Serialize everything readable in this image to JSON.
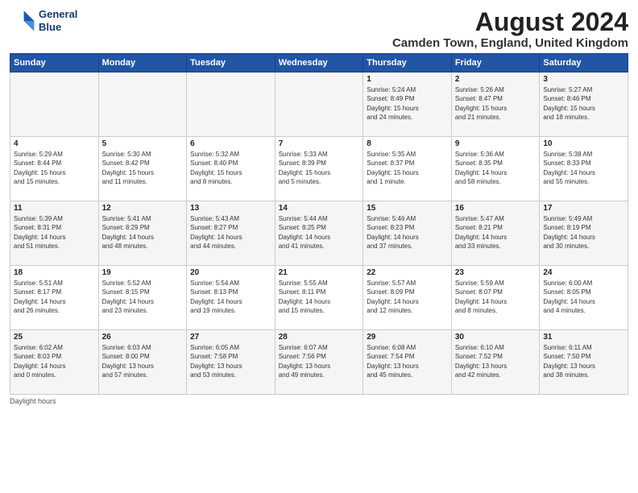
{
  "header": {
    "logo_line1": "General",
    "logo_line2": "Blue",
    "month_year": "August 2024",
    "location": "Camden Town, England, United Kingdom"
  },
  "columns": [
    "Sunday",
    "Monday",
    "Tuesday",
    "Wednesday",
    "Thursday",
    "Friday",
    "Saturday"
  ],
  "weeks": [
    {
      "days": [
        {
          "num": "",
          "info": ""
        },
        {
          "num": "",
          "info": ""
        },
        {
          "num": "",
          "info": ""
        },
        {
          "num": "",
          "info": ""
        },
        {
          "num": "1",
          "info": "Sunrise: 5:24 AM\nSunset: 8:49 PM\nDaylight: 15 hours\nand 24 minutes."
        },
        {
          "num": "2",
          "info": "Sunrise: 5:26 AM\nSunset: 8:47 PM\nDaylight: 15 hours\nand 21 minutes."
        },
        {
          "num": "3",
          "info": "Sunrise: 5:27 AM\nSunset: 8:46 PM\nDaylight: 15 hours\nand 18 minutes."
        }
      ]
    },
    {
      "days": [
        {
          "num": "4",
          "info": "Sunrise: 5:29 AM\nSunset: 8:44 PM\nDaylight: 15 hours\nand 15 minutes."
        },
        {
          "num": "5",
          "info": "Sunrise: 5:30 AM\nSunset: 8:42 PM\nDaylight: 15 hours\nand 11 minutes."
        },
        {
          "num": "6",
          "info": "Sunrise: 5:32 AM\nSunset: 8:40 PM\nDaylight: 15 hours\nand 8 minutes."
        },
        {
          "num": "7",
          "info": "Sunrise: 5:33 AM\nSunset: 8:39 PM\nDaylight: 15 hours\nand 5 minutes."
        },
        {
          "num": "8",
          "info": "Sunrise: 5:35 AM\nSunset: 8:37 PM\nDaylight: 15 hours\nand 1 minute."
        },
        {
          "num": "9",
          "info": "Sunrise: 5:36 AM\nSunset: 8:35 PM\nDaylight: 14 hours\nand 58 minutes."
        },
        {
          "num": "10",
          "info": "Sunrise: 5:38 AM\nSunset: 8:33 PM\nDaylight: 14 hours\nand 55 minutes."
        }
      ]
    },
    {
      "days": [
        {
          "num": "11",
          "info": "Sunrise: 5:39 AM\nSunset: 8:31 PM\nDaylight: 14 hours\nand 51 minutes."
        },
        {
          "num": "12",
          "info": "Sunrise: 5:41 AM\nSunset: 8:29 PM\nDaylight: 14 hours\nand 48 minutes."
        },
        {
          "num": "13",
          "info": "Sunrise: 5:43 AM\nSunset: 8:27 PM\nDaylight: 14 hours\nand 44 minutes."
        },
        {
          "num": "14",
          "info": "Sunrise: 5:44 AM\nSunset: 8:25 PM\nDaylight: 14 hours\nand 41 minutes."
        },
        {
          "num": "15",
          "info": "Sunrise: 5:46 AM\nSunset: 8:23 PM\nDaylight: 14 hours\nand 37 minutes."
        },
        {
          "num": "16",
          "info": "Sunrise: 5:47 AM\nSunset: 8:21 PM\nDaylight: 14 hours\nand 33 minutes."
        },
        {
          "num": "17",
          "info": "Sunrise: 5:49 AM\nSunset: 8:19 PM\nDaylight: 14 hours\nand 30 minutes."
        }
      ]
    },
    {
      "days": [
        {
          "num": "18",
          "info": "Sunrise: 5:51 AM\nSunset: 8:17 PM\nDaylight: 14 hours\nand 26 minutes."
        },
        {
          "num": "19",
          "info": "Sunrise: 5:52 AM\nSunset: 8:15 PM\nDaylight: 14 hours\nand 23 minutes."
        },
        {
          "num": "20",
          "info": "Sunrise: 5:54 AM\nSunset: 8:13 PM\nDaylight: 14 hours\nand 19 minutes."
        },
        {
          "num": "21",
          "info": "Sunrise: 5:55 AM\nSunset: 8:11 PM\nDaylight: 14 hours\nand 15 minutes."
        },
        {
          "num": "22",
          "info": "Sunrise: 5:57 AM\nSunset: 8:09 PM\nDaylight: 14 hours\nand 12 minutes."
        },
        {
          "num": "23",
          "info": "Sunrise: 5:59 AM\nSunset: 8:07 PM\nDaylight: 14 hours\nand 8 minutes."
        },
        {
          "num": "24",
          "info": "Sunrise: 6:00 AM\nSunset: 8:05 PM\nDaylight: 14 hours\nand 4 minutes."
        }
      ]
    },
    {
      "days": [
        {
          "num": "25",
          "info": "Sunrise: 6:02 AM\nSunset: 8:03 PM\nDaylight: 14 hours\nand 0 minutes."
        },
        {
          "num": "26",
          "info": "Sunrise: 6:03 AM\nSunset: 8:00 PM\nDaylight: 13 hours\nand 57 minutes."
        },
        {
          "num": "27",
          "info": "Sunrise: 6:05 AM\nSunset: 7:58 PM\nDaylight: 13 hours\nand 53 minutes."
        },
        {
          "num": "28",
          "info": "Sunrise: 6:07 AM\nSunset: 7:56 PM\nDaylight: 13 hours\nand 49 minutes."
        },
        {
          "num": "29",
          "info": "Sunrise: 6:08 AM\nSunset: 7:54 PM\nDaylight: 13 hours\nand 45 minutes."
        },
        {
          "num": "30",
          "info": "Sunrise: 6:10 AM\nSunset: 7:52 PM\nDaylight: 13 hours\nand 42 minutes."
        },
        {
          "num": "31",
          "info": "Sunrise: 6:11 AM\nSunset: 7:50 PM\nDaylight: 13 hours\nand 38 minutes."
        }
      ]
    }
  ],
  "footer": "Daylight hours"
}
